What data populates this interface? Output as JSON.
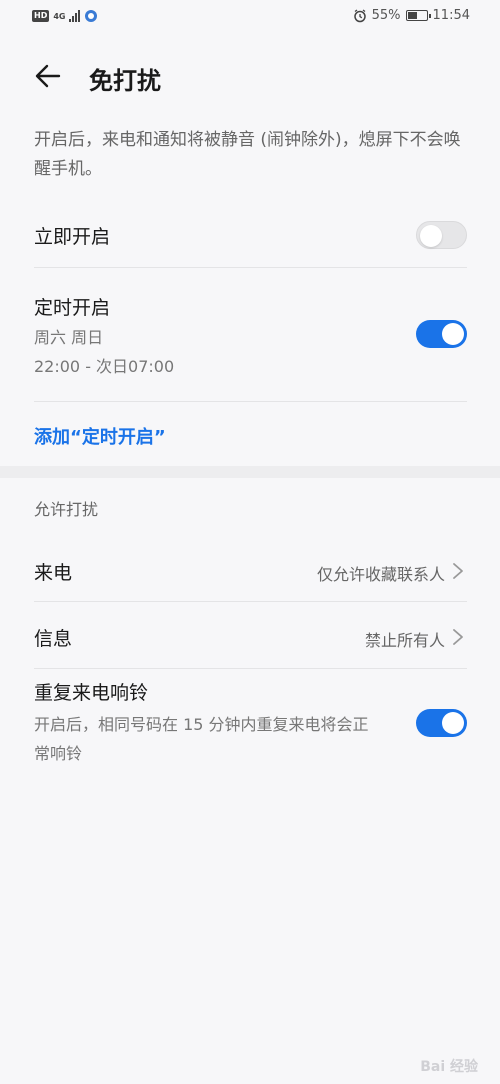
{
  "status_bar": {
    "hd": "HD",
    "network": "4G",
    "battery_percent": "55%",
    "battery_level": 0.55,
    "time": "11:54"
  },
  "header": {
    "title": "免打扰"
  },
  "description": "开启后，来电和通知将被静音 (闹钟除外)，熄屏下不会唤醒手机。",
  "immediate": {
    "label": "立即开启",
    "enabled": false
  },
  "scheduled": {
    "label": "定时开启",
    "days": "周六 周日",
    "time_range": "22:00 - 次日07:00",
    "enabled": true
  },
  "add_schedule_label": "添加“定时开启”",
  "allow_section": {
    "title": "允许打扰",
    "calls": {
      "label": "来电",
      "value": "仅允许收藏联系人"
    },
    "messages": {
      "label": "信息",
      "value": "禁止所有人"
    },
    "repeat_calls": {
      "label": "重复来电响铃",
      "desc": "开启后，相同号码在 15 分钟内重复来电将会正常响铃",
      "enabled": true
    }
  },
  "colors": {
    "accent": "#1a73e8",
    "background": "#f7f7f9"
  }
}
